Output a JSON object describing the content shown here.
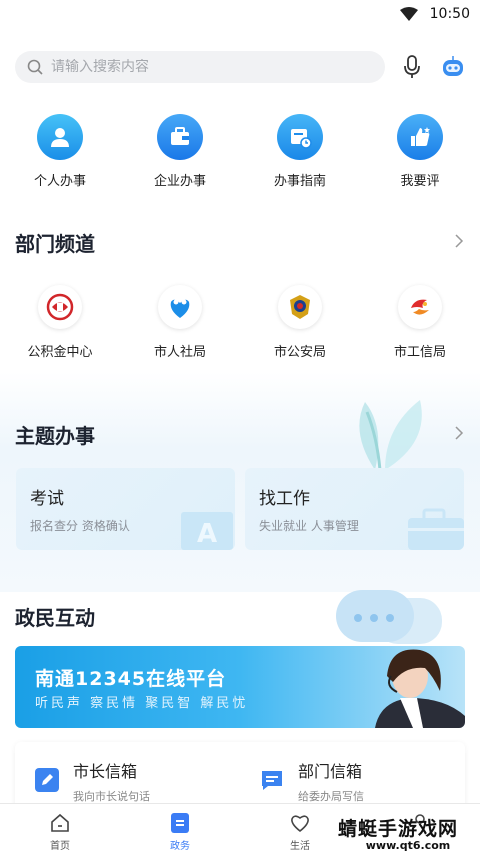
{
  "status": {
    "time": "10:50"
  },
  "search": {
    "placeholder": "请输入搜索内容"
  },
  "quick_actions": [
    {
      "label": "个人办事",
      "icon": "person-icon"
    },
    {
      "label": "企业办事",
      "icon": "briefcase-icon"
    },
    {
      "label": "办事指南",
      "icon": "guide-clock-icon"
    },
    {
      "label": "我要评",
      "icon": "thumbs-up-icon"
    }
  ],
  "departments": {
    "title": "部门频道",
    "items": [
      {
        "label": "公积金中心",
        "icon": "housing-fund-logo-icon"
      },
      {
        "label": "市人社局",
        "icon": "social-security-logo-icon"
      },
      {
        "label": "市公安局",
        "icon": "police-badge-icon"
      },
      {
        "label": "市工信局",
        "icon": "industry-logo-icon"
      }
    ]
  },
  "themes": {
    "title": "主题办事",
    "cards": [
      {
        "title": "考试",
        "subtitle": "报名查分 资格确认"
      },
      {
        "title": "找工作",
        "subtitle": "失业就业 人事管理"
      }
    ]
  },
  "interaction": {
    "title": "政民互动",
    "banner": {
      "title": "南通12345在线平台",
      "subtitle": "听民声 察民情 聚民智 解民忧"
    },
    "mailboxes": [
      {
        "title": "市长信箱",
        "subtitle": "我向市长说句话",
        "icon": "pencil-icon"
      },
      {
        "title": "部门信箱",
        "subtitle": "给委办局写信",
        "icon": "message-icon"
      }
    ]
  },
  "tabs": [
    {
      "label": "首页",
      "icon": "home-icon"
    },
    {
      "label": "政务",
      "icon": "document-icon"
    },
    {
      "label": "生活",
      "icon": "heart-icon"
    },
    {
      "label": "",
      "icon": "user-icon"
    }
  ],
  "watermark": {
    "line1": "蜻蜓手游戏网",
    "line2": "www.qt6.com"
  },
  "colors": {
    "accent": "#3b7cf5",
    "quick_icon": "#2e9cf0"
  }
}
